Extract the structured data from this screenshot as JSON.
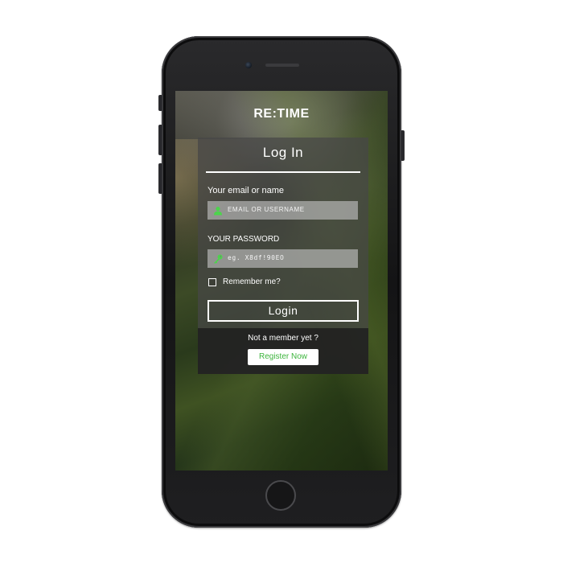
{
  "app": {
    "brand": "RE:TIME"
  },
  "login_card": {
    "title": "Log In",
    "email_label": "Your email or name",
    "email_placeholder": "EMAIL OR USERNAME",
    "password_label": "YOUR PASSWORD",
    "password_placeholder": "eg. X8df!90EO",
    "remember_label": "Remember me?",
    "remember_checked": false,
    "login_label": "Login",
    "footer_text": "Not a member yet ?",
    "register_label": "Register Now"
  },
  "icons": {
    "email_icon": "user-icon",
    "password_icon": "key-icon"
  },
  "colors": {
    "accent_green": "#3db53d",
    "icon_green": "#4cd44c"
  }
}
